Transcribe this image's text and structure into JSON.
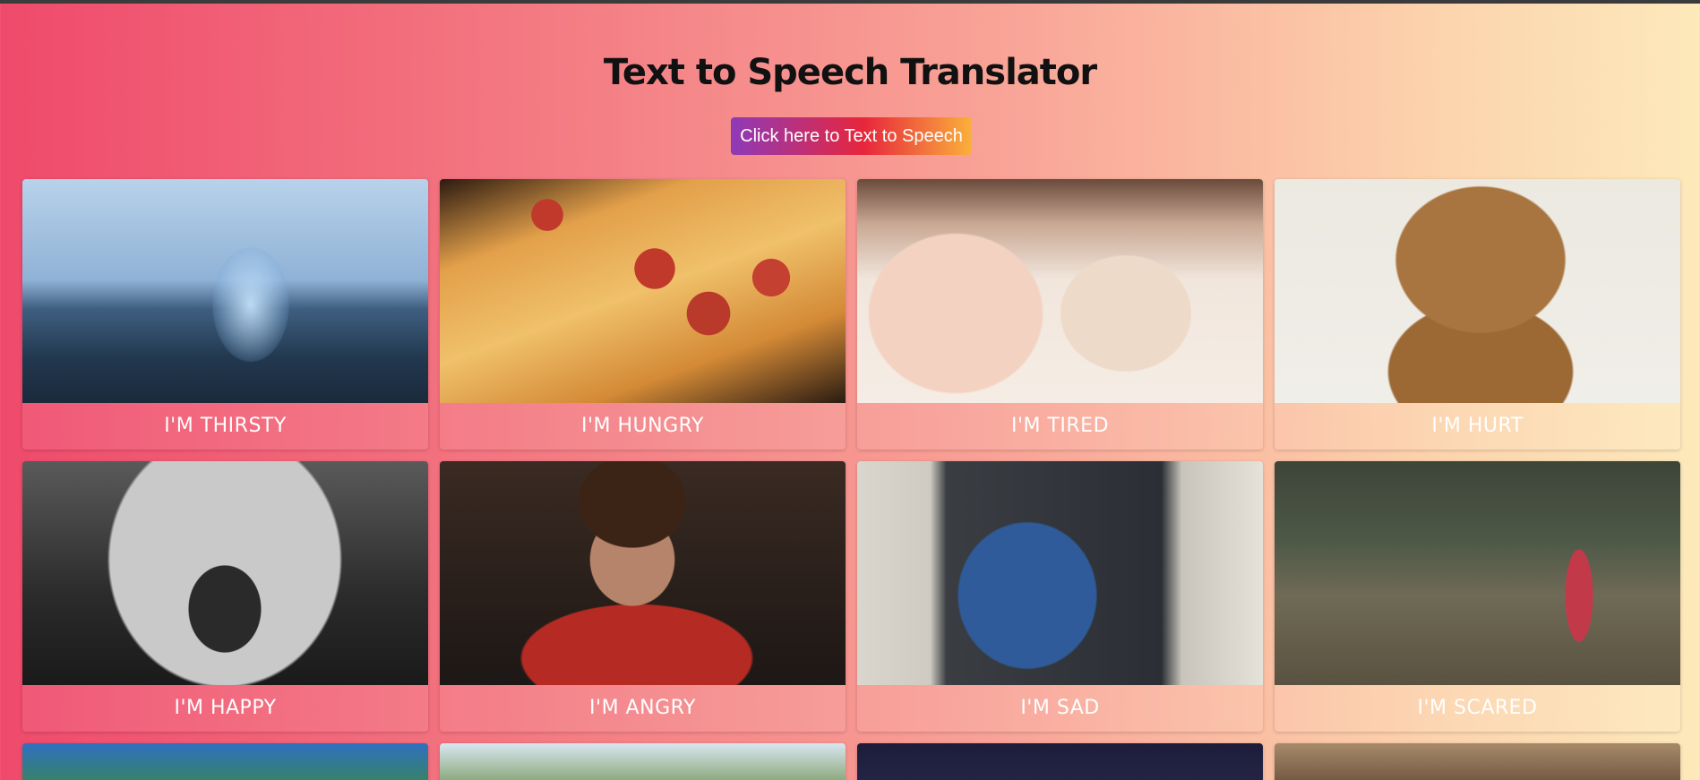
{
  "page": {
    "title": "Text to Speech Translator",
    "tts_button_label": "Click here to Text to Speech"
  },
  "cards": [
    {
      "label": "I'M THIRSTY"
    },
    {
      "label": "I'M HUNGRY"
    },
    {
      "label": "I'M TIRED"
    },
    {
      "label": "I'M HURT"
    },
    {
      "label": "I'M HAPPY"
    },
    {
      "label": "I'M ANGRY"
    },
    {
      "label": "I'M SAD"
    },
    {
      "label": "I'M SCARED"
    }
  ],
  "colors": {
    "background_start": "#ef4a6b",
    "background_end": "#fde9bb",
    "button_gradient_start": "#8e3ab8",
    "button_gradient_mid": "#e7263c",
    "button_gradient_end": "#fbb03b",
    "label_text": "#ffffff"
  }
}
